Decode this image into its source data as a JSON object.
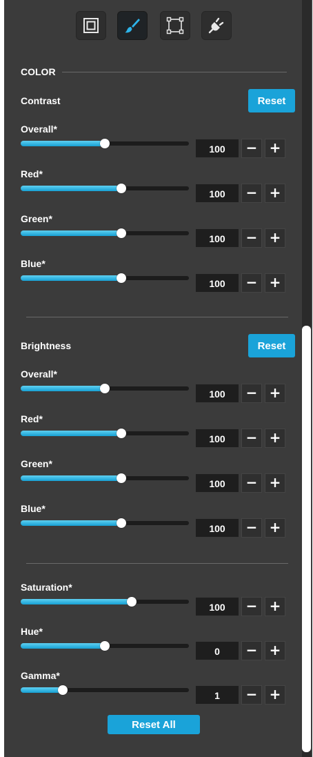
{
  "toolbar": {
    "tools": [
      {
        "icon": "frame-icon",
        "active": false
      },
      {
        "icon": "brush-icon",
        "active": true
      },
      {
        "icon": "crop-selection-icon",
        "active": false
      },
      {
        "icon": "plug-icon",
        "active": false
      }
    ]
  },
  "section": {
    "title": "COLOR"
  },
  "contrast": {
    "title": "Contrast",
    "reset_label": "Reset",
    "controls": [
      {
        "label": "Overall*",
        "value": "100",
        "fraction": 0.5
      },
      {
        "label": "Red*",
        "value": "100",
        "fraction": 0.6
      },
      {
        "label": "Green*",
        "value": "100",
        "fraction": 0.6
      },
      {
        "label": "Blue*",
        "value": "100",
        "fraction": 0.6
      }
    ]
  },
  "brightness": {
    "title": "Brightness",
    "reset_label": "Reset",
    "controls": [
      {
        "label": "Overall*",
        "value": "100",
        "fraction": 0.5
      },
      {
        "label": "Red*",
        "value": "100",
        "fraction": 0.6
      },
      {
        "label": "Green*",
        "value": "100",
        "fraction": 0.6
      },
      {
        "label": "Blue*",
        "value": "100",
        "fraction": 0.6
      }
    ]
  },
  "other": {
    "controls": [
      {
        "label": "Saturation*",
        "value": "100",
        "fraction": 0.66
      },
      {
        "label": "Hue*",
        "value": "0",
        "fraction": 0.5
      },
      {
        "label": "Gamma*",
        "value": "1",
        "fraction": 0.25
      }
    ]
  },
  "stepper": {
    "minus": "−",
    "plus": "+"
  },
  "reset_all_label": "Reset All",
  "colors": {
    "accent": "#1aa3d9",
    "panel": "#3b3b3b",
    "value_box": "#1e1e1e"
  }
}
